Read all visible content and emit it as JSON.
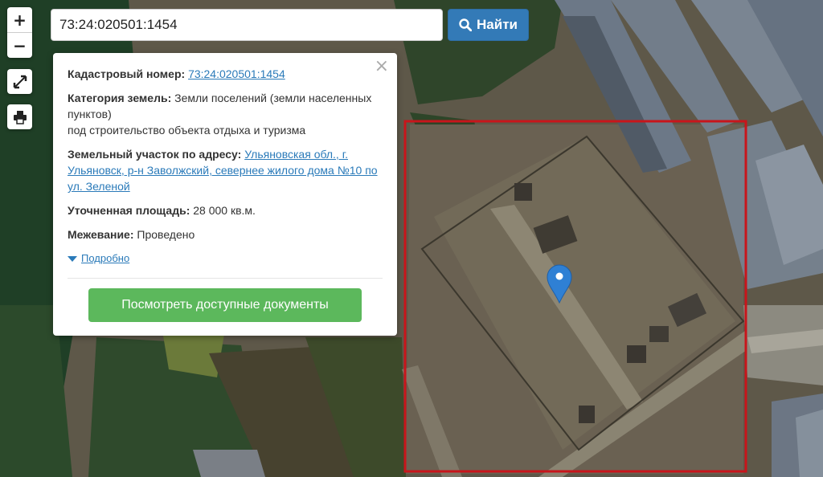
{
  "map": {
    "zoom_in_label": "+",
    "zoom_out_label": "−",
    "boundary_color": "#c8151b",
    "marker_color": "#2f80d4"
  },
  "search": {
    "value": "73:24:020501:1454",
    "button_label": "Найти"
  },
  "popup": {
    "cadastral_label": "Кадастровый номер:",
    "cadastral_value": "73:24:020501:1454",
    "category_label": "Категория земель:",
    "category_value": "Земли поселений (земли населенных пунктов)",
    "category_usage": "под строительство объекта отдыха и туризма",
    "address_label": "Земельный участок по адресу:",
    "address_value": "Ульяновская обл., г. Ульяновск, р-н Заволжский, севернее жилого дома №10 по ул. Зеленой",
    "area_label": "Уточненная площадь:",
    "area_value": "28 000 кв.м.",
    "survey_label": "Межевание:",
    "survey_value": "Проведено",
    "more_label": "Подробно",
    "documents_button": "Посмотреть доступные документы",
    "close_label": "×"
  }
}
